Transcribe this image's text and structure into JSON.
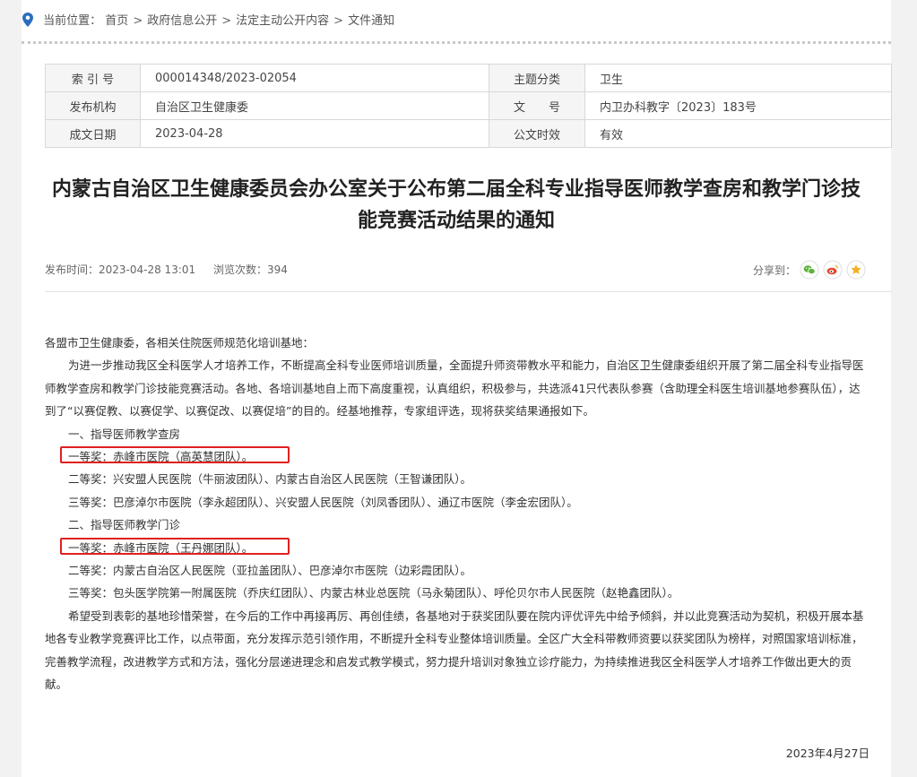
{
  "breadcrumb": {
    "prefix": "当前位置：",
    "items": [
      "首页",
      "政府信息公开",
      "法定主动公开内容",
      "文件通知"
    ],
    "separator": ">"
  },
  "meta": {
    "rows": [
      {
        "label1": "索 引 号",
        "value1": "000014348/2023-02054",
        "label2": "主题分类",
        "value2": "卫生"
      },
      {
        "label1": "发布机构",
        "value1": "自治区卫生健康委",
        "label2": "文　　号",
        "value2": "内卫办科教字〔2023〕183号"
      },
      {
        "label1": "成文日期",
        "value1": "2023-04-28",
        "label2": "公文时效",
        "value2": "有效"
      }
    ]
  },
  "article": {
    "title_line1": "内蒙古自治区卫生健康委员会办公室关于公布第二届全科专业指导医师教学查房和教学门诊技",
    "title_line2": "能竞赛活动结果的通知",
    "publish_time": "发布时间：2023-04-28 13:01",
    "views": "浏览次数：394",
    "share_label": "分享到：",
    "salutation": "各盟市卫生健康委，各相关住院医师规范化培训基地：",
    "para1": "为进一步推动我区全科医学人才培养工作，不断提高全科专业医师培训质量，全面提升师资带教水平和能力，自治区卫生健康委组织开展了第二届全科专业指导医师教学查房和教学门诊技能竞赛活动。各地、各培训基地自上而下高度重视，认真组织，积极参与，共选派41只代表队参赛（含助理全科医生培训基地参赛队伍），达到了“以赛促教、以赛促学、以赛促改、以赛促培”的目的。经基地推荐，专家组评选，现将获奖结果通报如下。",
    "section1": "一、指导医师教学查房",
    "s1_first": "一等奖：赤峰市医院（高英慧团队）。",
    "s1_second": "二等奖：兴安盟人民医院（牛丽波团队）、内蒙古自治区人民医院（王智谦团队）。",
    "s1_third": "三等奖：巴彦淖尔市医院（李永超团队）、兴安盟人民医院（刘凤香团队）、通辽市医院（李金宏团队）。",
    "section2": "二、指导医师教学门诊",
    "s2_first": "一等奖：赤峰市医院（王丹娜团队）。",
    "s2_second": "二等奖：内蒙古自治区人民医院（亚拉盖团队）、巴彦淖尔市医院（边彩霞团队）。",
    "s2_third": "三等奖：包头医学院第一附属医院（乔庆红团队）、内蒙古林业总医院（马永菊团队）、呼伦贝尔市人民医院（赵艳鑫团队）。",
    "para2": "希望受到表彰的基地珍惜荣誉，在今后的工作中再接再厉、再创佳绩，各基地对于获奖团队要在院内评优评先中给予倾斜，并以此竞赛活动为契机，积极开展本基地各专业教学竞赛评比工作，以点带面，充分发挥示范引领作用，不断提升全科专业整体培训质量。全区广大全科带教师资要以获奖团队为榜样，对照国家培训标准，完善教学流程，改进教学方式和方法，强化分层递进理念和启发式教学模式，努力提升培训对象独立诊疗能力，为持续推进我区全科医学人才培养工作做出更大的贡献。",
    "date": "2023年4月27日"
  },
  "icons": {
    "location": "location-pin-icon",
    "wechat": "wechat-icon",
    "weibo": "weibo-icon",
    "favorite": "star-icon"
  },
  "colors": {
    "highlight_box": "#e02020",
    "location": "#2a6ebd",
    "wechat": "#5bb33c",
    "weibo": "#e8492e",
    "star": "#f1b225"
  }
}
